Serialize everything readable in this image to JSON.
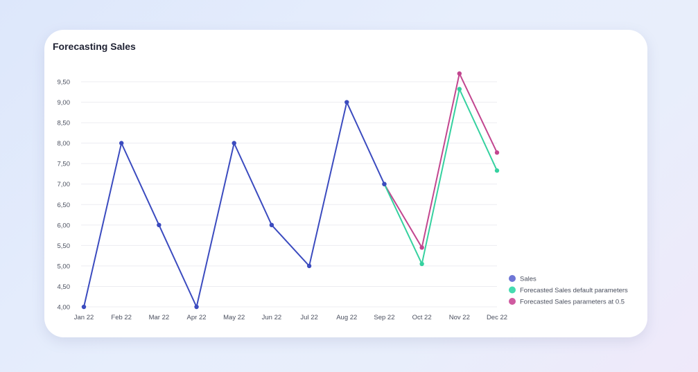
{
  "card": {
    "title": "Forecasting Sales"
  },
  "chart_data": {
    "type": "line",
    "title": "Forecasting Sales",
    "xlabel": "",
    "ylabel": "",
    "categories": [
      "Jan 22",
      "Feb 22",
      "Mar 22",
      "Apr 22",
      "May 22",
      "Jun 22",
      "Jul 22",
      "Aug 22",
      "Sep 22",
      "Oct 22",
      "Nov 22",
      "Dec 22"
    ],
    "yticks": [
      "4,00",
      "4,50",
      "5,00",
      "5,50",
      "6,00",
      "6,50",
      "7,00",
      "7,50",
      "8,00",
      "8,50",
      "9,00",
      "9,50"
    ],
    "ylim": [
      4,
      9.5
    ],
    "grid": true,
    "legend_position": "bottom-right",
    "series": [
      {
        "name": "Sales",
        "color": "#3b4bbf",
        "legend_color": "#6f76d6",
        "values": [
          4.0,
          8.0,
          6.0,
          4.0,
          8.0,
          6.0,
          5.0,
          9.0,
          7.0,
          null,
          null,
          null
        ]
      },
      {
        "name": "Forecasted Sales default parameters",
        "color": "#35d19f",
        "legend_color": "#45dbb0",
        "values": [
          null,
          null,
          null,
          null,
          null,
          null,
          null,
          null,
          7.0,
          5.05,
          9.32,
          7.33
        ]
      },
      {
        "name": "Forecasted Sales parameters at 0.5",
        "color": "#c2468f",
        "legend_color": "#cf5aa0",
        "values": [
          null,
          null,
          null,
          null,
          null,
          null,
          null,
          null,
          7.0,
          5.45,
          9.7,
          7.77
        ]
      }
    ]
  }
}
